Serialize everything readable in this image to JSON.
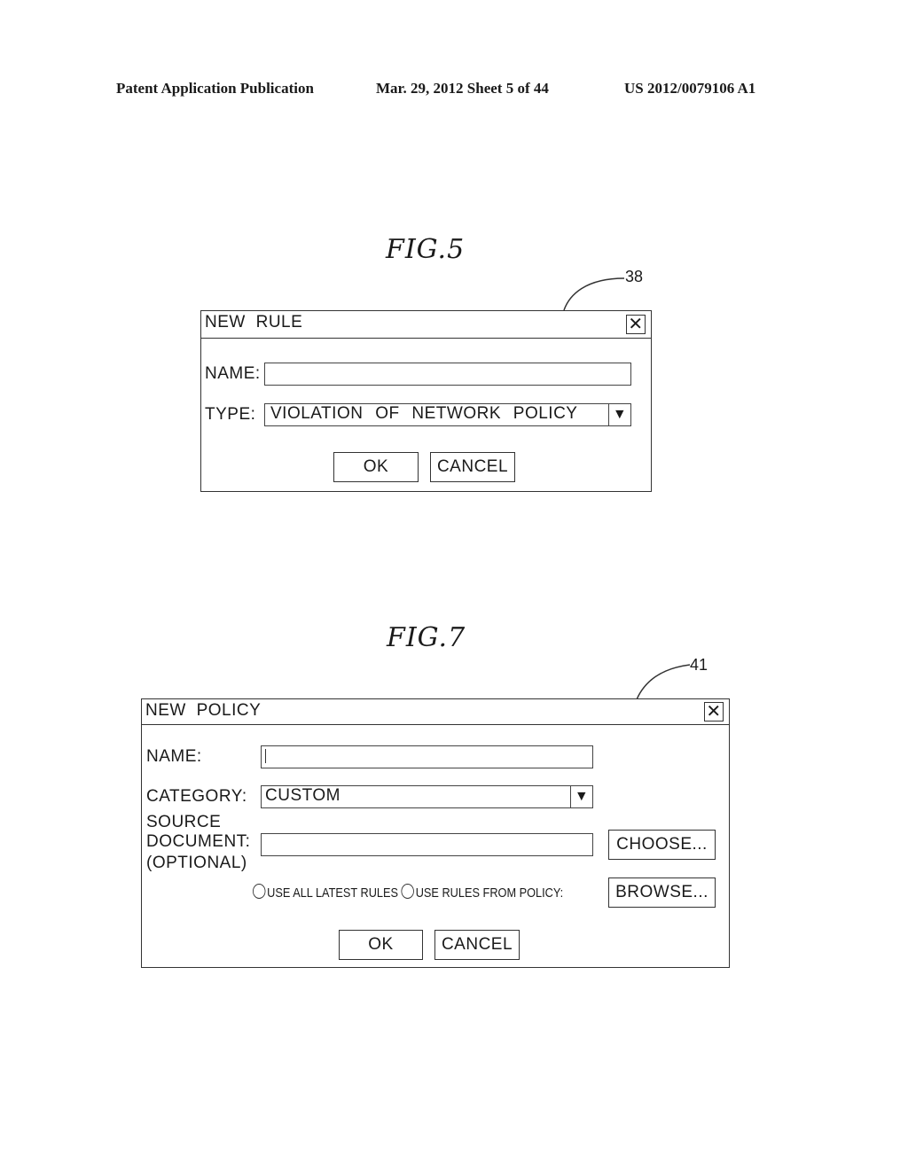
{
  "header": {
    "publication": "Patent Application Publication",
    "date_sheet": "Mar. 29, 2012  Sheet 5 of 44",
    "pub_number": "US 2012/0079106 A1"
  },
  "fig5": {
    "caption": "FIG.5",
    "reference": "38",
    "dialog": {
      "title": "NEW RULE",
      "close_icon": "close-icon",
      "name_label": "NAME:",
      "name_value": "",
      "type_label": "TYPE:",
      "type_value": "VIOLATION OF NETWORK POLICY",
      "dropdown_icon": "▼",
      "ok_label": "OK",
      "cancel_label": "CANCEL"
    }
  },
  "fig7": {
    "caption": "FIG.7",
    "reference": "41",
    "dialog": {
      "title": "NEW POLICY",
      "close_icon": "close-icon",
      "name_label": "NAME:",
      "name_value": "",
      "category_label": "CATEGORY:",
      "category_value": "CUSTOM",
      "dropdown_icon": "▼",
      "source_label_1": "SOURCE",
      "source_label_2": "DOCUMENT:",
      "source_label_3": "(OPTIONAL)",
      "source_value": "",
      "choose_label": "CHOOSE...",
      "radio_latest_label": "USE ALL LATEST RULES",
      "radio_policy_label": "USE RULES FROM POLICY:",
      "browse_label": "BROWSE...",
      "ok_label": "OK",
      "cancel_label": "CANCEL"
    }
  }
}
